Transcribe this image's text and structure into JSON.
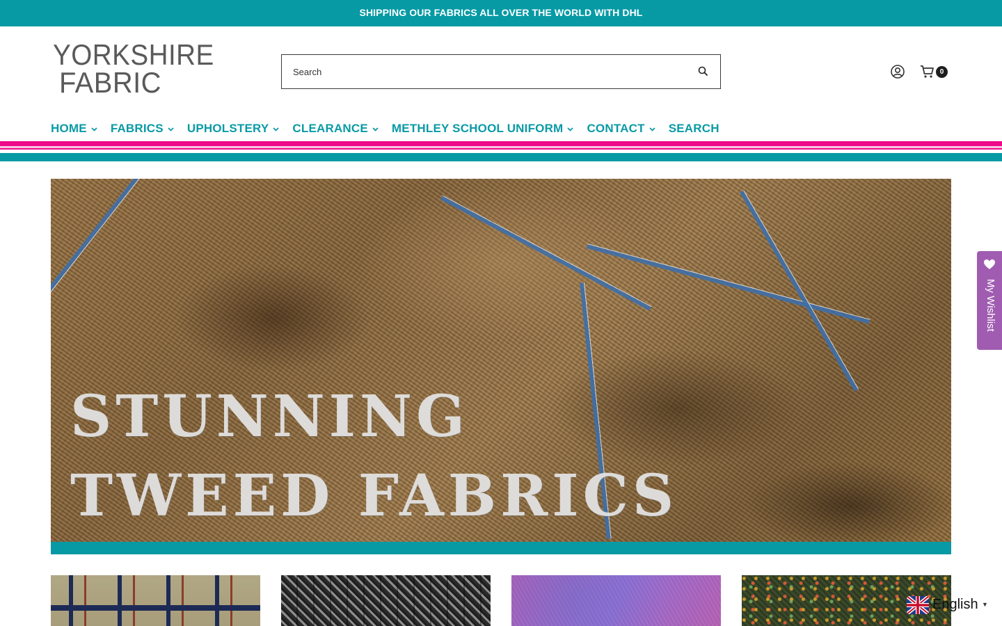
{
  "announcement": "SHIPPING OUR FABRICS ALL OVER THE WORLD WITH DHL",
  "logo": {
    "line1": "YORKSHIRE",
    "line2": "FABRIC"
  },
  "search": {
    "placeholder": "Search"
  },
  "cart": {
    "count": "0"
  },
  "nav": [
    {
      "label": "HOME",
      "has_dropdown": true
    },
    {
      "label": "FABRICS",
      "has_dropdown": true
    },
    {
      "label": "UPHOLSTERY",
      "has_dropdown": true
    },
    {
      "label": "CLEARANCE",
      "has_dropdown": true
    },
    {
      "label": "METHLEY SCHOOL UNIFORM",
      "has_dropdown": true
    },
    {
      "label": "CONTACT",
      "has_dropdown": true
    },
    {
      "label": "SEARCH",
      "has_dropdown": false
    }
  ],
  "hero": {
    "line1": "STUNNING",
    "line2": "TWEED FABRICS"
  },
  "tiles": [
    {
      "name": "navy-check-tweed"
    },
    {
      "name": "grey-herringbone-tweed"
    },
    {
      "name": "purple-tweed"
    },
    {
      "name": "green-donegal-tweed"
    }
  ],
  "wishlist": {
    "label": "My Wishlist"
  },
  "language": {
    "selected": "English",
    "flag": "uk-flag-icon"
  },
  "colors": {
    "teal": "#079aa5",
    "pink": "#ee0a88",
    "purple": "#a05cb1",
    "logo_grey": "#5a5a5a"
  }
}
